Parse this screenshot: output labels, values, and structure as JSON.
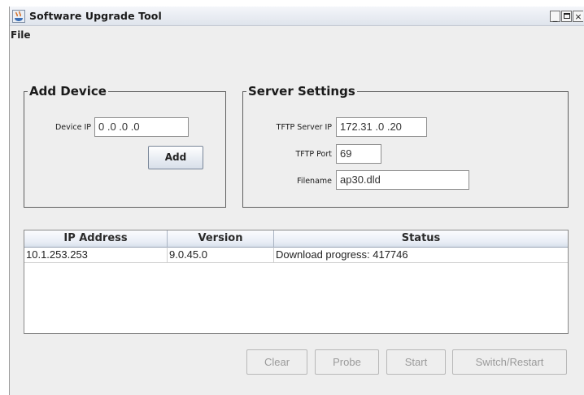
{
  "window": {
    "title": "Software Upgrade Tool",
    "controls": {
      "minimize": "_",
      "maximize": "□",
      "close": "×"
    }
  },
  "menu": {
    "file": "File"
  },
  "add_device": {
    "legend": "Add Device",
    "device_ip_label": "Device IP",
    "device_ip_value": "0 .0 .0 .0",
    "add_button": "Add"
  },
  "server_settings": {
    "legend": "Server Settings",
    "tftp_server_ip_label": "TFTP Server IP",
    "tftp_server_ip_value": "172.31 .0 .20",
    "tftp_port_label": "TFTP Port",
    "tftp_port_value": "69",
    "filename_label": "Filename",
    "filename_value": "ap30.dld"
  },
  "devices_table": {
    "columns": [
      "IP Address",
      "Version",
      "Status"
    ],
    "rows": [
      [
        "10.1.253.253",
        "9.0.45.0",
        "Download progress: 417746"
      ]
    ]
  },
  "actions": {
    "clear": "Clear",
    "probe": "Probe",
    "start": "Start",
    "switch_restart": "Switch/Restart"
  }
}
